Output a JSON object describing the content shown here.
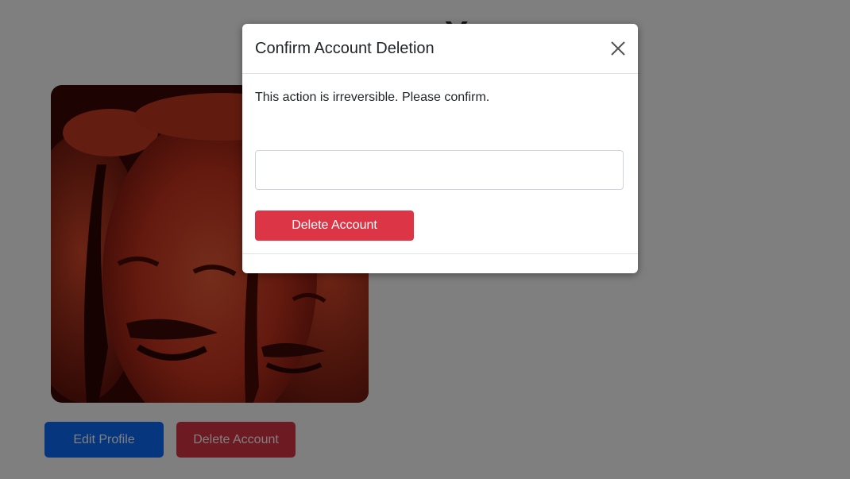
{
  "page": {
    "title": "Y",
    "edit_profile_label": "Edit Profile",
    "delete_account_label": "Delete Account",
    "avatar_alt": "",
    "colors": {
      "background": "#ffffff",
      "primary": "#0d6efd",
      "danger": "#dc3545",
      "overlay": "rgba(0,0,0,0.98)"
    }
  },
  "modal": {
    "title": "Confirm Account Deletion",
    "message": "This action is irreversible. Please confirm.",
    "input_value": "",
    "input_placeholder": "",
    "delete_button_label": "Delete Account",
    "close_icon": "close-icon"
  }
}
